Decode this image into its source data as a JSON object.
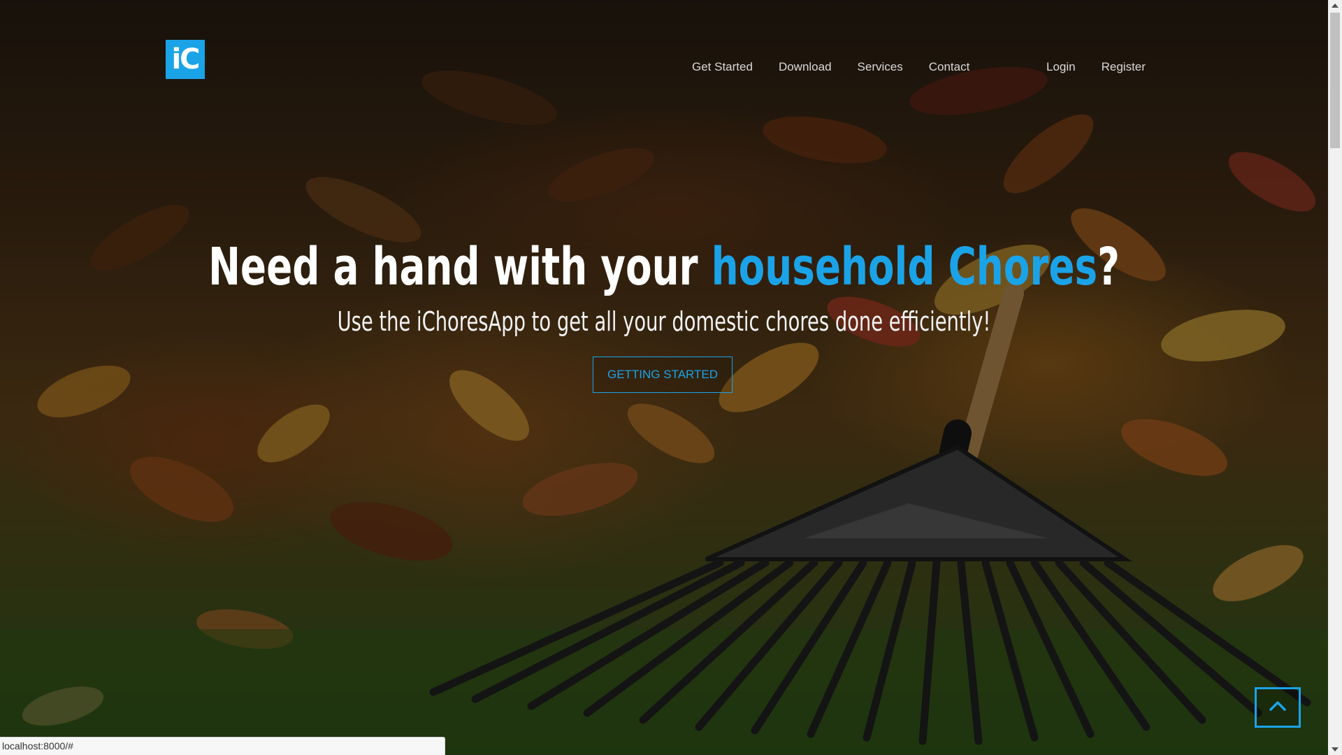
{
  "header": {
    "logo_text": "iC",
    "nav_main": [
      "Get Started",
      "Download",
      "Services",
      "Contact"
    ],
    "nav_auth": [
      "Login",
      "Register"
    ]
  },
  "hero": {
    "title_lead": "Need a hand with your ",
    "title_accent": "household Chores",
    "title_end": "?",
    "subtitle": "Use the iChoresApp to get all your domestic chores done efficiently!",
    "cta_label": "GETTING STARTED"
  },
  "status_bar": {
    "url": "localhost:8000/#"
  },
  "icons": {
    "back_to_top": "chevron-up-icon",
    "scroll_up": "scroll-up-arrow-icon",
    "scroll_down": "scroll-down-arrow-icon"
  },
  "colors": {
    "accent": "#1ba3e8",
    "nav_text": "#d9d9d9",
    "hero_text": "#ffffff"
  }
}
